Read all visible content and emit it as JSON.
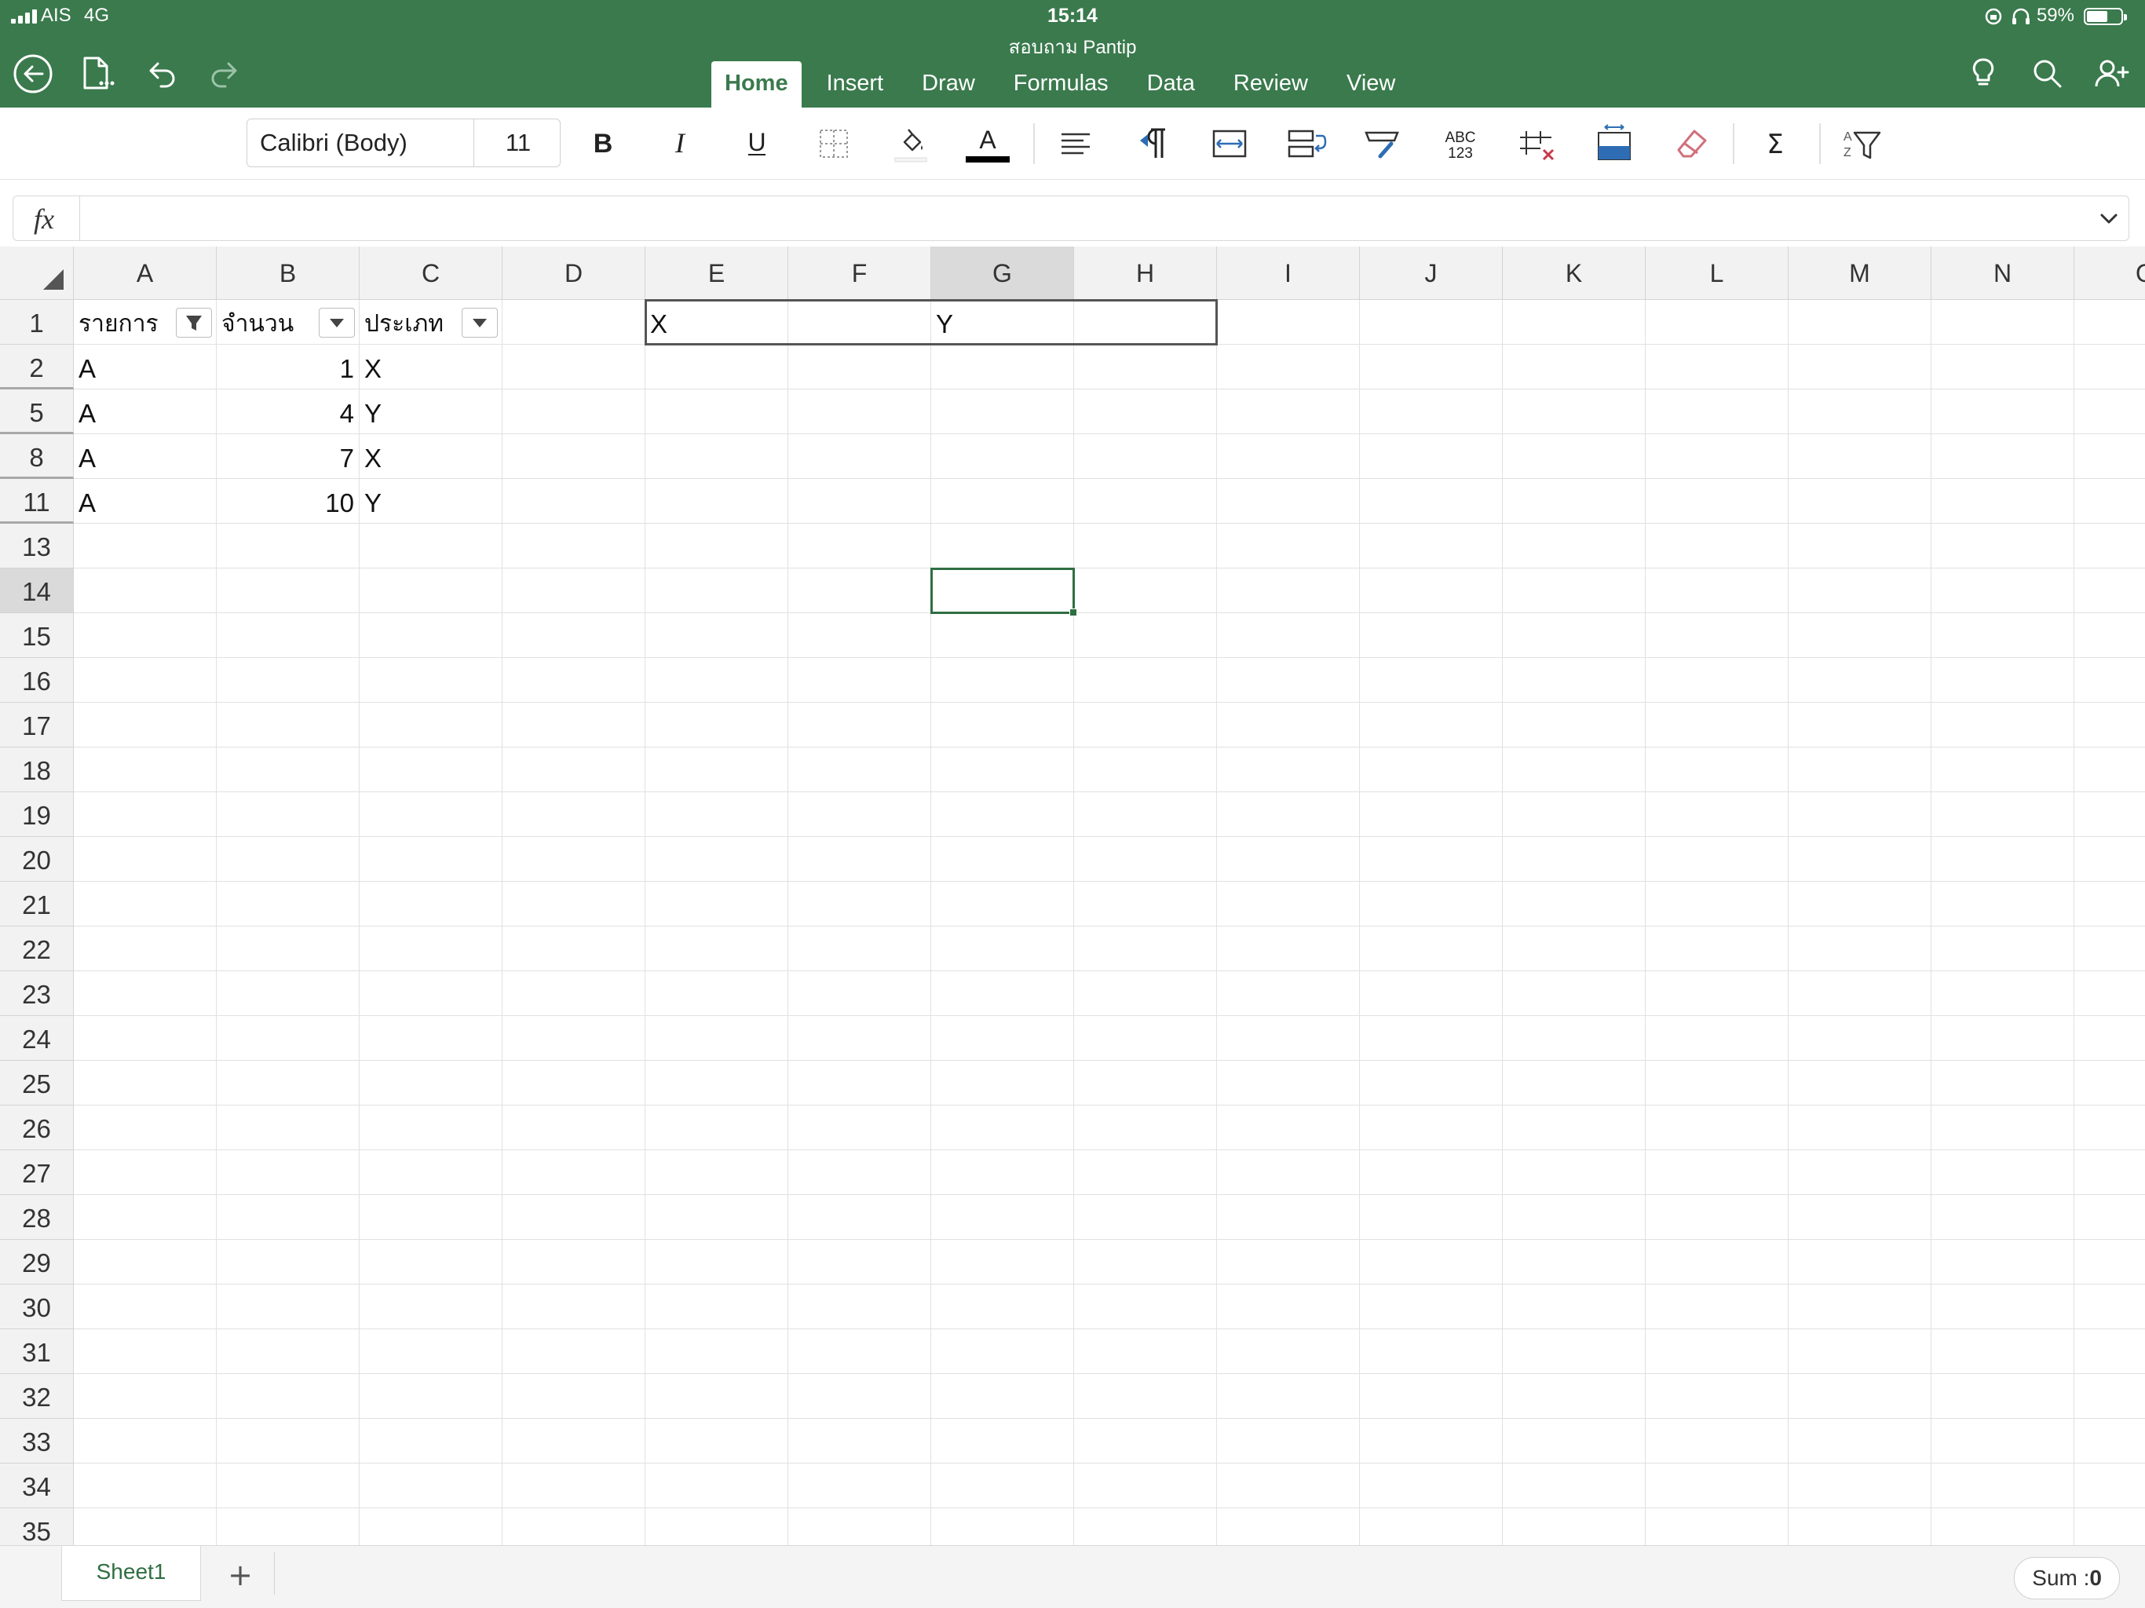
{
  "status_bar": {
    "carrier": "AIS",
    "network": "4G",
    "time": "15:14",
    "document_title": "สอบถาม Pantip",
    "battery_percent": "59%"
  },
  "tabs": [
    {
      "label": "Home",
      "active": true
    },
    {
      "label": "Insert",
      "active": false
    },
    {
      "label": "Draw",
      "active": false
    },
    {
      "label": "Formulas",
      "active": false
    },
    {
      "label": "Data",
      "active": false
    },
    {
      "label": "Review",
      "active": false
    },
    {
      "label": "View",
      "active": false
    }
  ],
  "ribbon": {
    "font_name": "Calibri (Body)",
    "font_size": "11",
    "bold_label": "B",
    "italic_label": "I",
    "underline_label": "U",
    "font_color_label": "A",
    "number_format_label_top": "ABC",
    "number_format_label_bottom": "123",
    "sum_label": "Σ",
    "sort_label_a": "A",
    "sort_label_z": "Z"
  },
  "formula_bar": {
    "label": "fx",
    "value": ""
  },
  "columns": [
    "A",
    "B",
    "C",
    "D",
    "E",
    "F",
    "G",
    "H",
    "I",
    "J",
    "K",
    "L",
    "M",
    "N",
    "O"
  ],
  "selected_column": "G",
  "rows": [
    "1",
    "2",
    "5",
    "8",
    "11",
    "13",
    "14",
    "15",
    "16",
    "17",
    "18",
    "19",
    "20",
    "21",
    "22",
    "23",
    "24",
    "25",
    "26",
    "27",
    "28",
    "29",
    "30",
    "31",
    "32",
    "33",
    "34",
    "35"
  ],
  "selected_row": "14",
  "header_row": [
    "รายการ",
    "จำนวน",
    "ประเภท"
  ],
  "data_rows": [
    [
      "A",
      "1",
      "X"
    ],
    [
      "A",
      "4",
      "Y"
    ],
    [
      "A",
      "7",
      "X"
    ],
    [
      "A",
      "10",
      "Y"
    ]
  ],
  "criteria_cells": {
    "E1": "X",
    "G1": "Y"
  },
  "sheet_tab": "Sheet1",
  "add_sheet": "+",
  "status": {
    "sum_label": "Sum :",
    "sum_value": "0"
  },
  "colors": {
    "accent": "#3a7a4d",
    "selection": "#2f6e42"
  }
}
